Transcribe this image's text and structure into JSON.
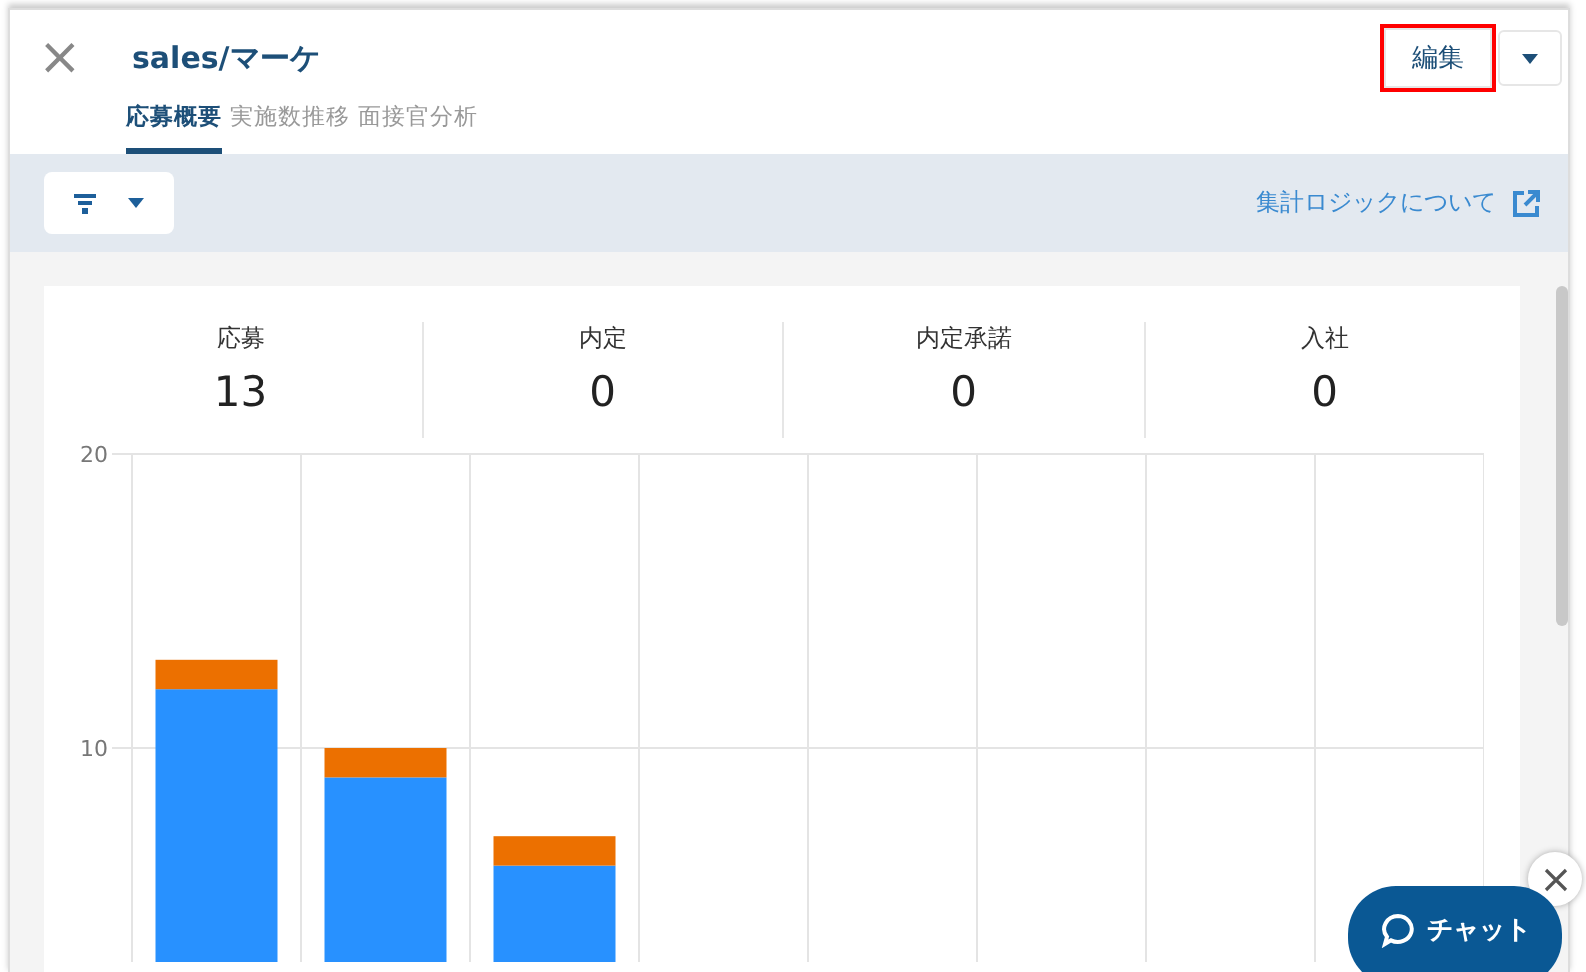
{
  "header": {
    "close": "×",
    "title": "sales/マーケ",
    "edit_button": {
      "label": "編集",
      "highlighted": true
    },
    "tabs": [
      {
        "label": "応募概要",
        "selected": true
      },
      {
        "label": "実施数推移",
        "selected": false
      },
      {
        "label": "面接官分析",
        "selected": false
      }
    ]
  },
  "toolbar": {
    "link": "集計ロジックについて"
  },
  "stats": [
    {
      "label": "応募",
      "value": "13"
    },
    {
      "label": "内定",
      "value": "0"
    },
    {
      "label": "内定承諾",
      "value": "0"
    },
    {
      "label": "入社",
      "value": "0"
    }
  ],
  "chart_data": {
    "type": "bar",
    "stacked": true,
    "ylim": [
      0,
      20
    ],
    "yticks": [
      10,
      20
    ],
    "series": [
      {
        "color": "#2891ff",
        "values": [
          12,
          9,
          6,
          0,
          0,
          0,
          0,
          0
        ]
      },
      {
        "color": "#ec7000",
        "values": [
          1,
          1,
          1,
          0,
          0,
          0,
          0,
          0
        ]
      }
    ]
  },
  "chat": {
    "label": "チャット"
  }
}
